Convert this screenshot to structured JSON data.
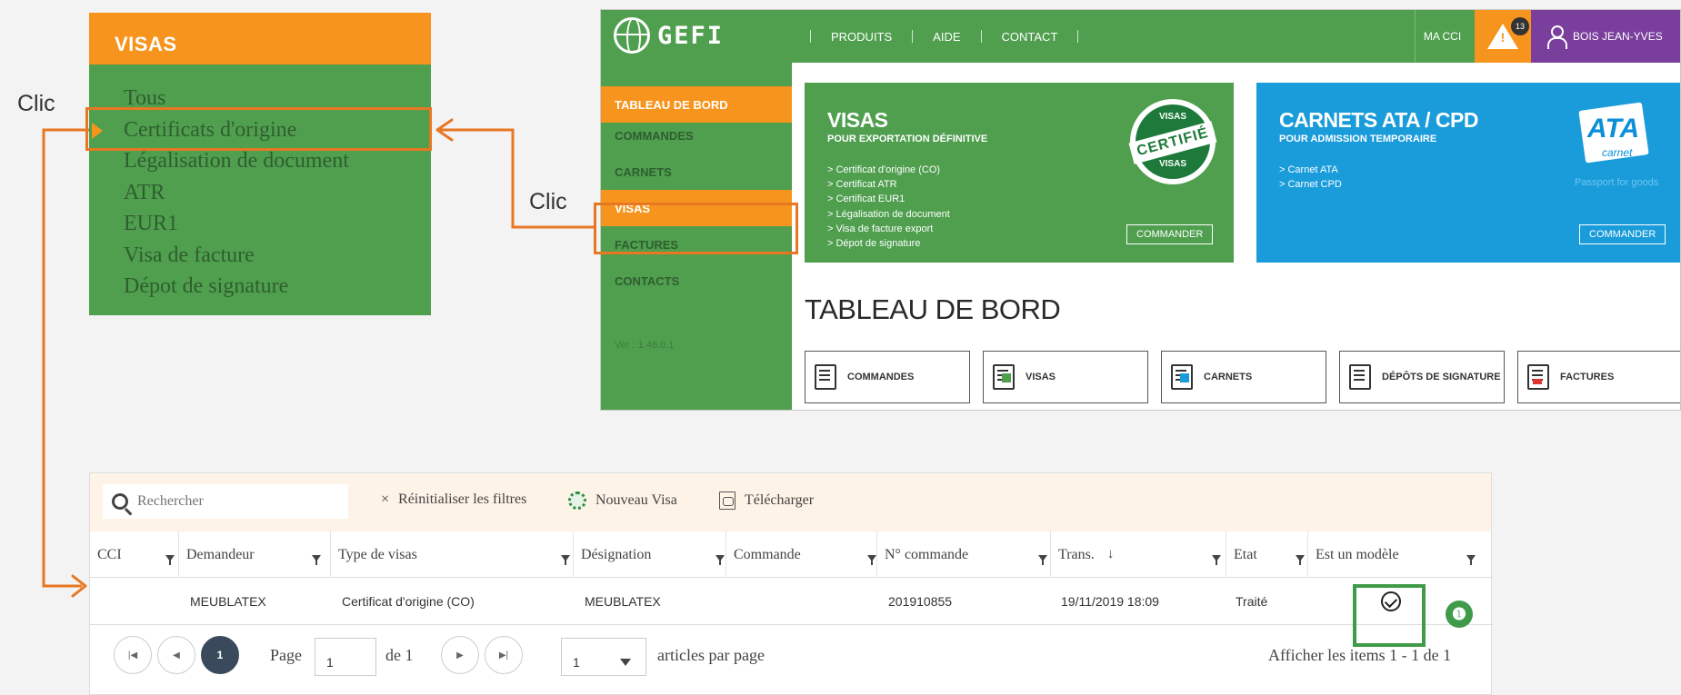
{
  "annotations": {
    "clic_left": "Clic",
    "clic_middle": "Clic",
    "step_badge": "❶"
  },
  "visas_menu": {
    "title": "VISAS",
    "items": [
      "Tous",
      "Certificats d'origine",
      "Légalisation de document",
      "ATR",
      "EUR1",
      "Visa de facture",
      "Dépot de signature"
    ],
    "selected_index": 1
  },
  "app": {
    "logo_text": "GEFI",
    "top_nav": [
      "PRODUITS",
      "AIDE",
      "CONTACT"
    ],
    "my_cci": "MA CCI",
    "notification_count": "13",
    "user_name": "BOIS JEAN-YVES",
    "sidebar": {
      "items": [
        "TABLEAU DE BORD",
        "COMMANDES",
        "CARNETS",
        "VISAS",
        "FACTURES",
        "CONTACTS"
      ],
      "active_top": "TABLEAU DE BORD",
      "version": "Ver : 1.46.0.1"
    },
    "cards": {
      "visas": {
        "title": "VISAS",
        "subtitle": "POUR EXPORTATION DÉFINITIVE",
        "lines": [
          "> Certificat d'origine (CO)",
          "> Certificat ATR",
          "> Certificat EUR1",
          "> Légalisation de document",
          "> Visa de facture export",
          "> Dépot de signature"
        ],
        "button": "COMMANDER",
        "stamp_top": "VISAS",
        "stamp_mid": "CERTIFIÉ",
        "stamp_bot": "VISAS"
      },
      "carnets": {
        "title": "CARNETS ATA / CPD",
        "subtitle": "POUR ADMISSION TEMPORAIRE",
        "lines": [
          "> Carnet ATA",
          "> Carnet CPD"
        ],
        "button": "COMMANDER",
        "logo_text": "ATA",
        "logo_sub": "carnet",
        "tagline": "Passport for goods"
      }
    },
    "dashboard_title": "TABLEAU DE BORD",
    "tiles": [
      "COMMANDES",
      "VISAS",
      "CARNETS",
      "DÉPÔTS DE SIGNATURE",
      "FACTURES"
    ]
  },
  "grid": {
    "search_placeholder": "Rechercher",
    "reset_filters": "Réinitialiser les filtres",
    "new_visa": "Nouveau Visa",
    "download": "Télécharger",
    "columns": [
      "CCI",
      "Demandeur",
      "Type de visas",
      "Désignation",
      "Commande",
      "N° commande",
      "Trans.",
      "Etat",
      "Est un modèle"
    ],
    "sort_indicator": "↓",
    "rows": [
      {
        "cci": "",
        "demandeur": "MEUBLATEX",
        "type": "Certificat d'origine (CO)",
        "designation": "MEUBLATEX",
        "commande": "",
        "numero": "201910855",
        "trans": "19/11/2019 18:09",
        "etat": "Traité",
        "modele": true
      }
    ],
    "pager": {
      "current_page": "1",
      "page_label": "Page",
      "page_value": "1",
      "of_label": "de 1",
      "per_page_value": "1",
      "per_page_label": "articles par page",
      "summary": "Afficher les items 1 - 1 de 1"
    }
  },
  "colors": {
    "orange": "#f7941d",
    "green": "#4f9f4f",
    "blue": "#1a9cdb",
    "purple": "#7a3e9d",
    "callout": "#e87722"
  }
}
